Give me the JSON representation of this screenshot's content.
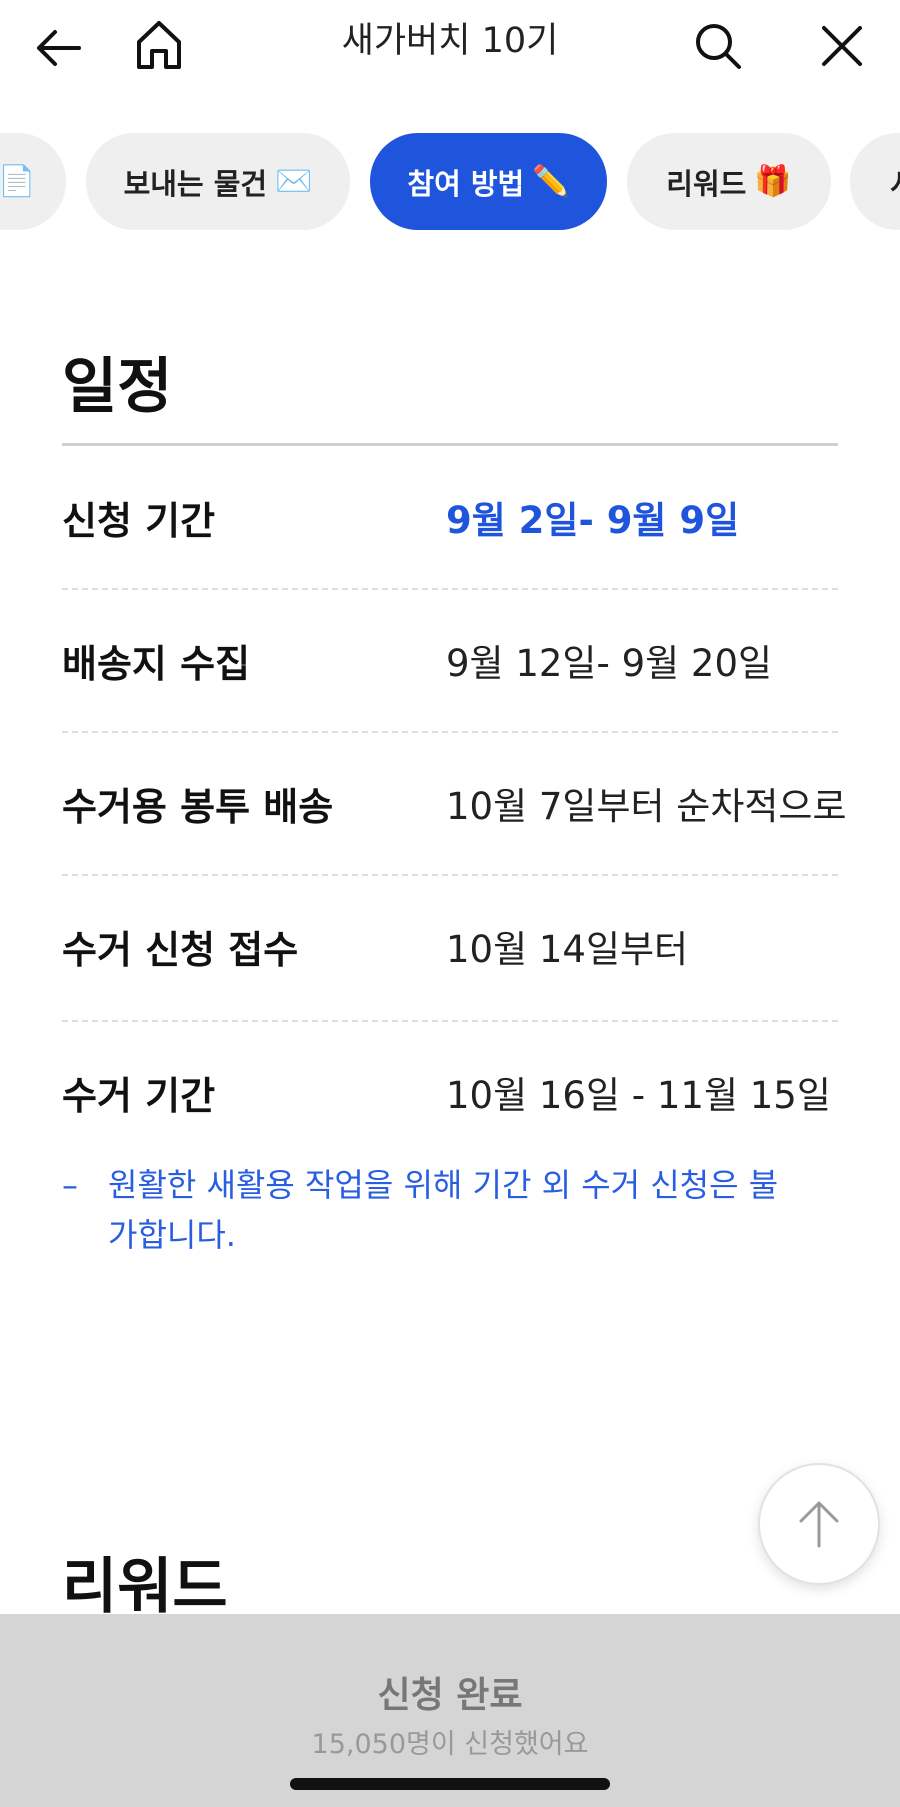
{
  "header": {
    "title": "새가버치 10기"
  },
  "tabs": [
    {
      "label": "",
      "emoji": "📄"
    },
    {
      "label": "보내는 물건",
      "emoji": "✉️"
    },
    {
      "label": "참여 방법",
      "emoji": "✏️"
    },
    {
      "label": "리워드",
      "emoji": "🎁"
    },
    {
      "label": "시",
      "emoji": ""
    }
  ],
  "schedule": {
    "title": "일정",
    "rows": [
      {
        "label": "신청 기간",
        "value": "9월 2일- 9월 9일"
      },
      {
        "label": "배송지 수집",
        "value": "9월 12일- 9월 20일"
      },
      {
        "label": "수거용 봉투 배송",
        "value": "10월 7일부터 순차적으로"
      },
      {
        "label": "수거 신청 접수",
        "value": "10월 14일부터"
      },
      {
        "label": "수거 기간",
        "value": "10월 16일 - 11월 15일"
      }
    ],
    "note": {
      "dash": "–",
      "text": "원활한 새활용 작업을 위해 기간 외 수거 신청은 불가합니다."
    }
  },
  "reward": {
    "title": "리워드"
  },
  "bottom_bar": {
    "label": "신청 완료",
    "sub": "15,050명이 신청했어요"
  },
  "colors": {
    "accent": "#1f55dc",
    "tab_inactive_bg": "#efefef",
    "bottom_bar_bg": "#d5d5d5"
  },
  "icons": {
    "back": "arrow-left-icon",
    "home": "home-icon",
    "search": "search-icon",
    "close": "close-icon",
    "scroll_top": "arrow-up-icon"
  }
}
